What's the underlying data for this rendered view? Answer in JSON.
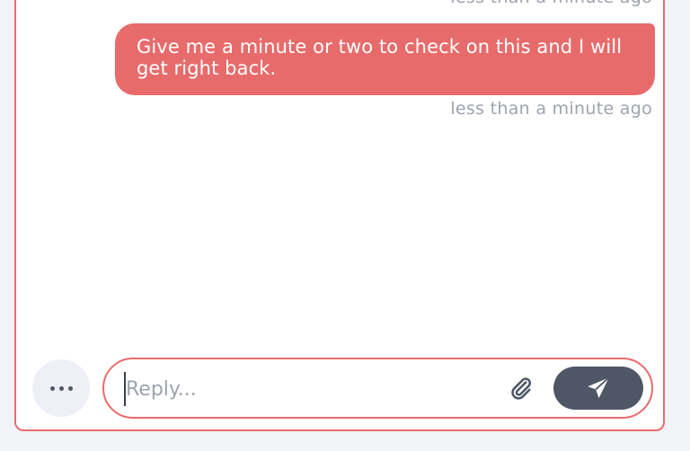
{
  "messages": [
    {
      "timestamp": "less than a minute ago"
    },
    {
      "text": "Give me a minute or two to check on this and I will get right back.",
      "timestamp": "less than a minute ago"
    }
  ],
  "composer": {
    "placeholder": "Reply...",
    "value": ""
  },
  "icons": {
    "options": "more-horizontal-icon",
    "attach": "paperclip-icon",
    "send": "paper-plane-icon"
  },
  "colors": {
    "accent": "#e86b6b",
    "send_button": "#4f5766",
    "timestamp": "#9ea3ad",
    "options_bg": "#eef0f6"
  }
}
